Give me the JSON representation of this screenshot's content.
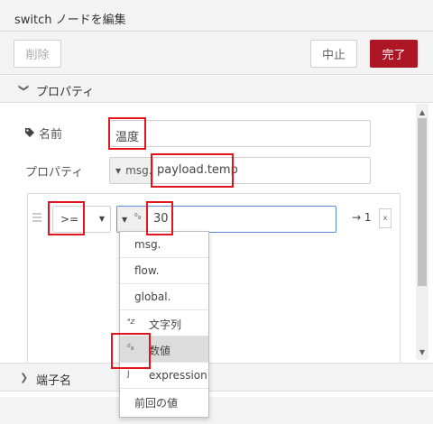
{
  "dialog": {
    "title": "switch ノードを編集"
  },
  "toolbar": {
    "delete_label": "削除",
    "cancel_label": "中止",
    "done_label": "完了"
  },
  "properties_section": {
    "label": "プロパティ"
  },
  "name_field": {
    "label": "名前",
    "value": "温度"
  },
  "property_field": {
    "label": "プロパティ",
    "type": "msg.",
    "value": "payload.temp"
  },
  "rule": {
    "operator": ">=",
    "value": "30",
    "output": "→ 1"
  },
  "type_menu": {
    "items": [
      {
        "label": "msg.",
        "icon": ""
      },
      {
        "label": "flow.",
        "icon": ""
      },
      {
        "label": "global.",
        "icon": ""
      },
      {
        "label": "文字列",
        "icon": "string-az-icon"
      },
      {
        "label": "数値",
        "icon": "number-09-icon",
        "selected": true
      },
      {
        "label": "expression",
        "icon": "jsonata-icon"
      },
      {
        "label": "前回の値",
        "icon": ""
      }
    ]
  },
  "ports_section": {
    "label": "端子名"
  },
  "colors": {
    "accent": "#ad1625",
    "highlight": "#e3131f",
    "focus_border": "#5b8ed6"
  }
}
